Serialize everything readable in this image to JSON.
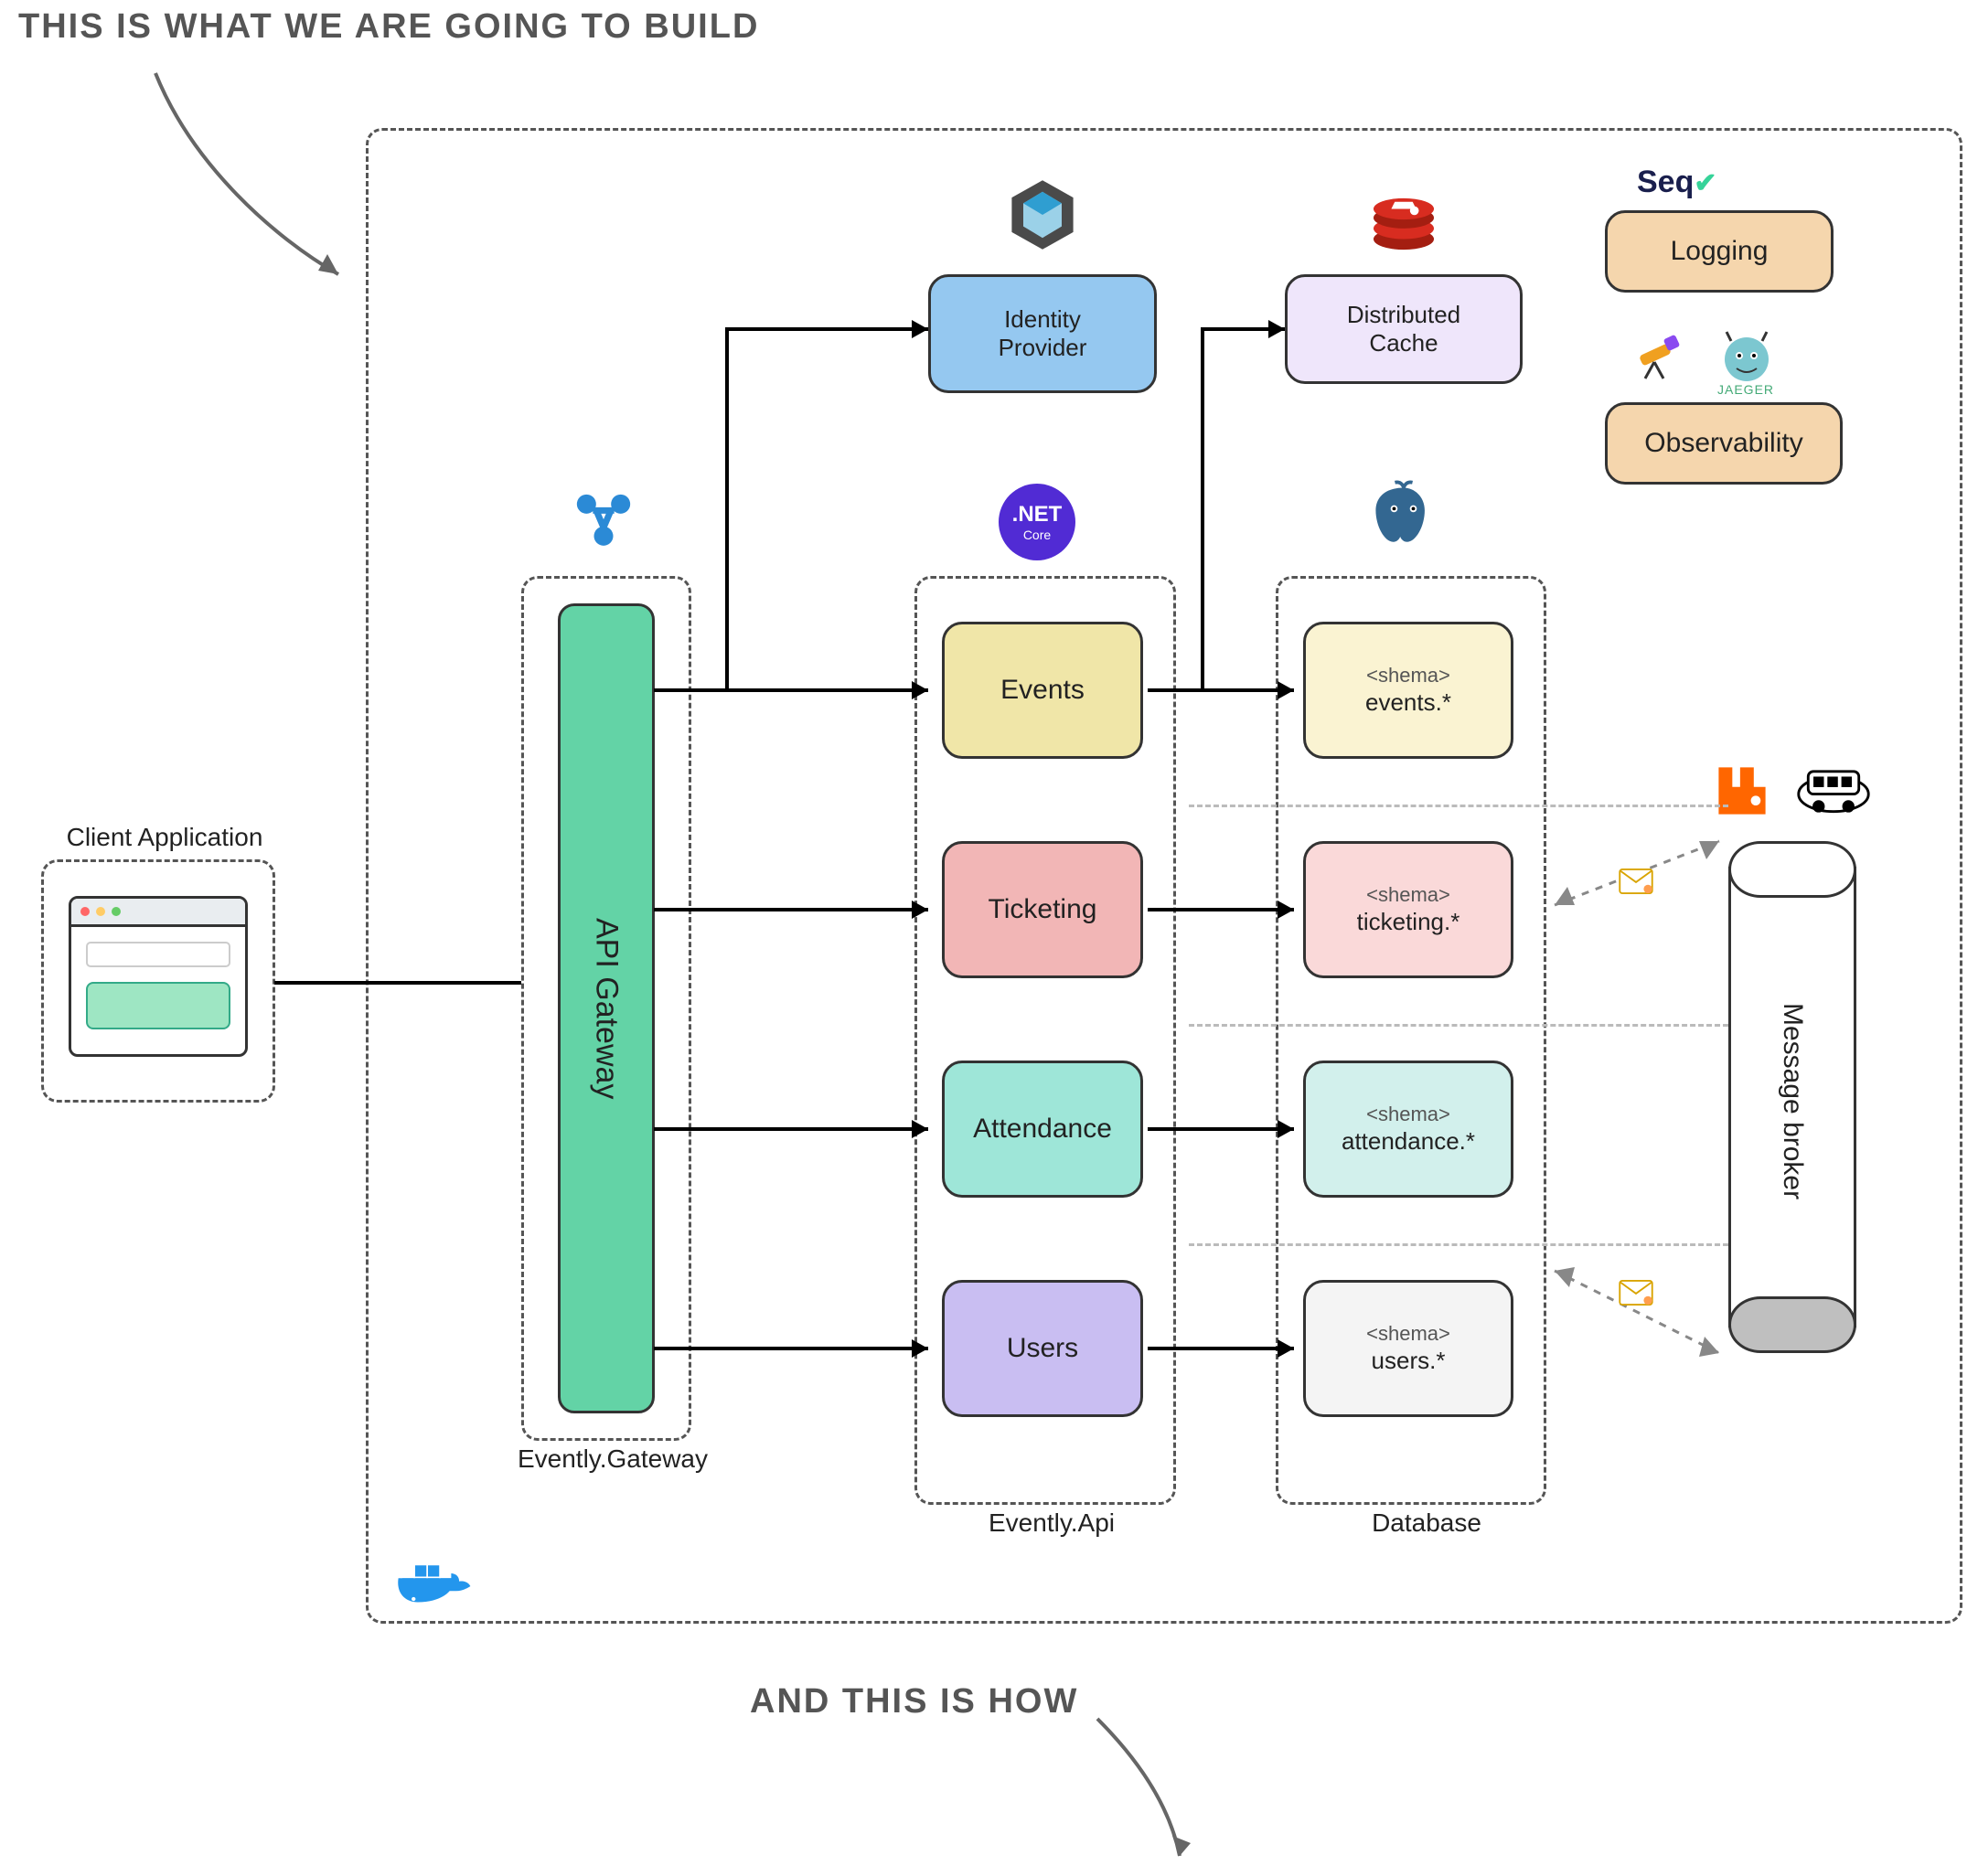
{
  "captions": {
    "top": "THIS IS WHAT WE ARE GOING TO BUILD",
    "bottom": "AND THIS IS HOW"
  },
  "client_app": {
    "title": "Client Application"
  },
  "gateway": {
    "bar_label": "API Gateway",
    "caption": "Evently.Gateway"
  },
  "identity": {
    "label": "Identity\nProvider"
  },
  "cache": {
    "label": "Distributed\nCache"
  },
  "evently_api": {
    "caption": "Evently.Api",
    "modules": {
      "events": "Events",
      "ticketing": "Ticketing",
      "attendance": "Attendance",
      "users": "Users"
    }
  },
  "database": {
    "caption": "Database",
    "schema_tag": "<shema>",
    "schemas": {
      "events": "events.*",
      "ticketing": "ticketing.*",
      "attendance": "attendance.*",
      "users": "users.*"
    }
  },
  "broker": {
    "label": "Message broker"
  },
  "observability": {
    "logging": "Logging",
    "observability": "Observability",
    "seq_brand": "Seq",
    "jaeger_brand": "JAEGER"
  },
  "icons": {
    "yarp": "yarp-icon",
    "keycloak": "keycloak-icon",
    "redis": "redis-icon",
    "dotnet": ".NET",
    "dotnet_sub": "Core",
    "postgres": "postgres-icon",
    "docker": "docker-icon",
    "rabbitmq": "rabbitmq-icon",
    "masstransit": "masstransit-icon",
    "telescope": "telescope-icon",
    "jaeger": "jaeger-icon",
    "seq": "seq-icon"
  },
  "colors": {
    "events": "#f0e6a8",
    "ticketing": "#f2b6b6",
    "attendance": "#9ee6d8",
    "users": "#c9bef2",
    "identity": "#95c8f0",
    "cache": "#efe6fb",
    "peach": "#f5d6ad",
    "mint": "#63d3a6"
  }
}
